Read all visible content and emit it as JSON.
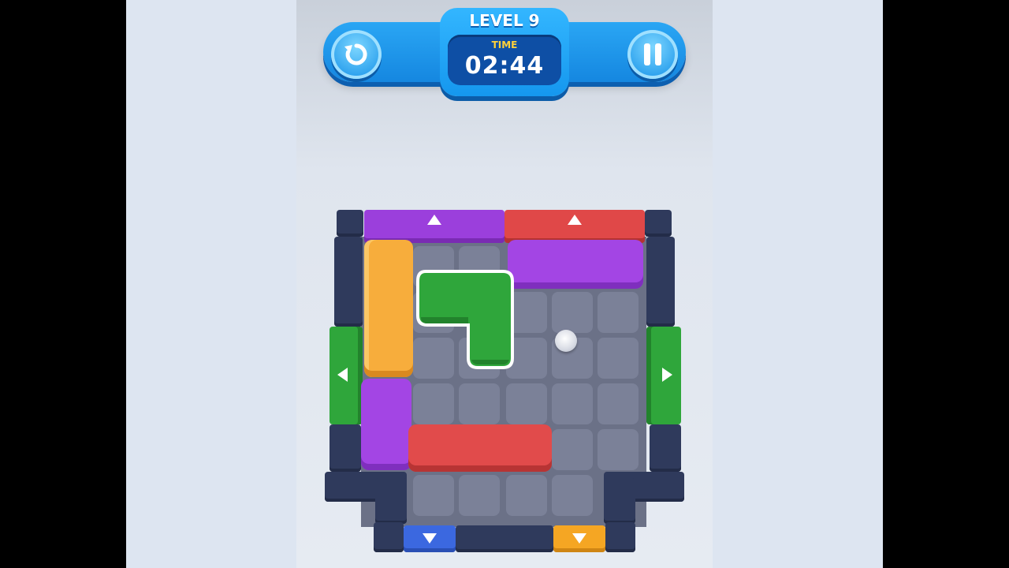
{
  "hud": {
    "level_text": "LEVEL 9",
    "time_label": "TIME",
    "time_value": "02:44"
  },
  "buttons": {
    "restart_icon": "restart-icon",
    "pause_icon": "pause-icon"
  },
  "board": {
    "columns": 5,
    "rows": 5,
    "exit_gates": [
      {
        "side": "top",
        "color": "#9b3fdc",
        "arrow": "up"
      },
      {
        "side": "top",
        "color": "#e04848",
        "arrow": "up"
      },
      {
        "side": "left",
        "color": "#2fa63b",
        "arrow": "left"
      },
      {
        "side": "right",
        "color": "#2fa63b",
        "arrow": "right"
      },
      {
        "side": "bottom",
        "color": "#3b68e0",
        "arrow": "down"
      },
      {
        "side": "bottom",
        "color": "#f5a623",
        "arrow": "down"
      }
    ],
    "blocks": [
      {
        "color": "#f7ad3c",
        "shape": "vertical-1x3"
      },
      {
        "color": "#a345e4",
        "shape": "horizontal-3x1"
      },
      {
        "color": "#2fa63b",
        "shape": "L",
        "selected": true
      },
      {
        "color": "#a345e4",
        "shape": "vertical-1x2"
      },
      {
        "color": "#e14b4b",
        "shape": "horizontal-3x1"
      }
    ]
  },
  "colors": {
    "hud_blue": "#1587e0",
    "timer_bg": "#0e4fa5",
    "time_label": "#ffd23a",
    "wall": "#2f3a5c",
    "floor_cell": "#7b8198"
  }
}
